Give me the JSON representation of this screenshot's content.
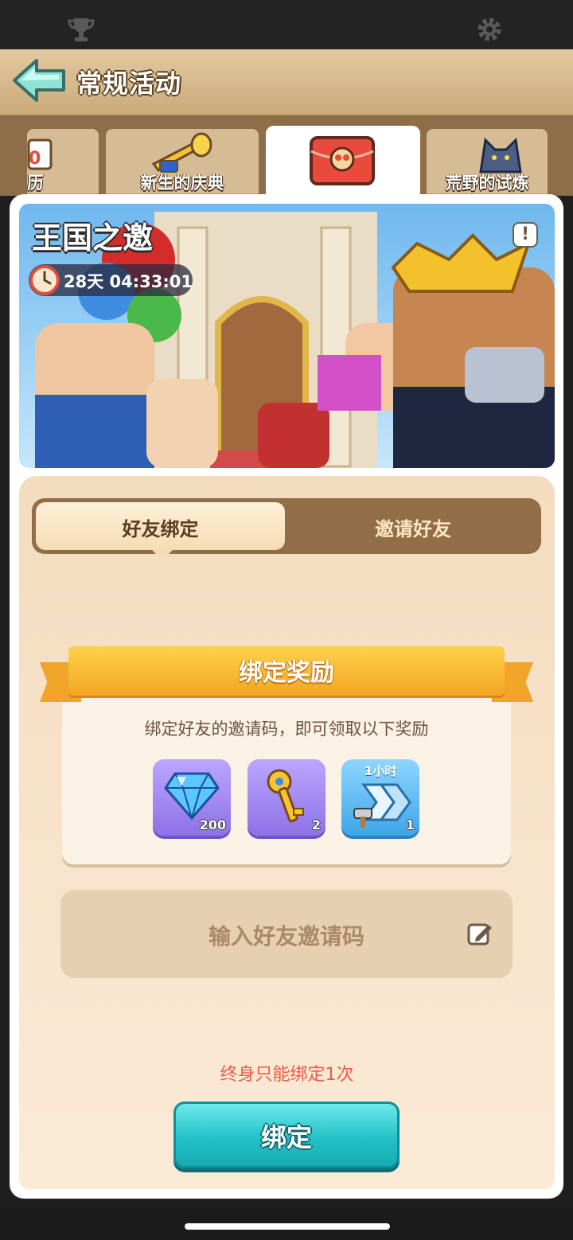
{
  "header": {
    "title": "常规活动"
  },
  "tabs": [
    {
      "label": "历"
    },
    {
      "label": "新生的庆典"
    },
    {
      "label": ""
    },
    {
      "label": "荒野的试炼"
    }
  ],
  "event": {
    "title": "王国之邀",
    "countdown": "28天 04:33:01",
    "info_symbol": "!"
  },
  "segment": {
    "left_label": "好友绑定",
    "right_label": "邀请好友"
  },
  "reward": {
    "title": "绑定奖励",
    "description": "绑定好友的邀请码，即可领取以下奖励",
    "items": [
      {
        "icon": "diamond-icon",
        "count": "200"
      },
      {
        "icon": "golden-key-icon",
        "count": "2"
      },
      {
        "icon": "speedup-hammer-icon",
        "tag": "1小时",
        "count": "1"
      }
    ]
  },
  "input": {
    "placeholder": "输入好友邀请码"
  },
  "limit_note": "终身只能绑定1次",
  "bind_button": {
    "label": "绑定"
  },
  "colors": {
    "accent": "#22c2c8",
    "ribbon": "#f3a523",
    "warning": "#f05a4a"
  }
}
